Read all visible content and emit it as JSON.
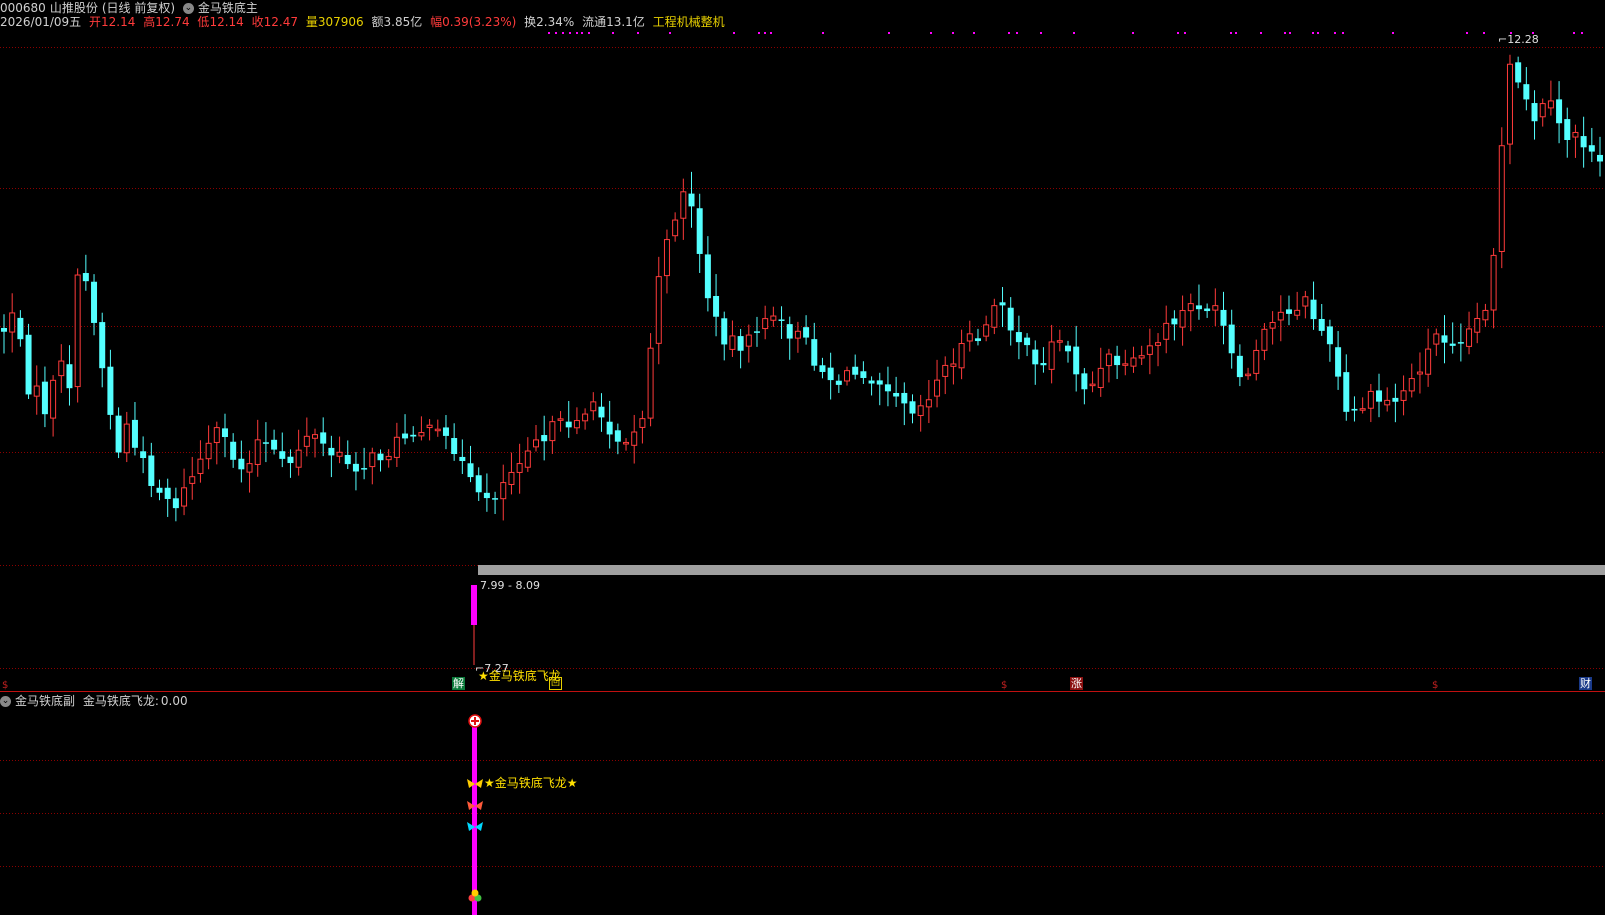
{
  "header": {
    "code": "000680",
    "name": "山推股份",
    "period": "(日线 前复权)",
    "indicator_main": "金马铁底主",
    "date": "2026/01/09",
    "weekday": "五",
    "open_label": "开",
    "open": "12.14",
    "high_label": "高",
    "high": "12.74",
    "low_label": "低",
    "low": "12.14",
    "close_label": "收",
    "close": "12.47",
    "vol_label": "量",
    "vol": "307906",
    "amt_label": "额",
    "amt": "3.85亿",
    "chg_label": "幅",
    "chg": "0.39(3.23%)",
    "turn_label": "换",
    "turn": "2.34%",
    "float_label": "流通",
    "float": "13.1亿",
    "industry": "工程机械整机"
  },
  "main_chart": {
    "high_marker": "12.28",
    "low_marker": "7.27",
    "zone_label": "7.99 - 8.09",
    "signal_text": "★金马铁底飞龙",
    "marks": {
      "jie": "解",
      "hui": "回",
      "zhang": "涨",
      "cai": "财"
    }
  },
  "sub_panel": {
    "title": "金马铁底副",
    "value_label": "金马铁底飞龙:",
    "value": "0.00",
    "signal_text": "★金马铁底飞龙★"
  },
  "colors": {
    "up": "#ff3b3b",
    "down": "#54ffff",
    "grid": "#8b0000",
    "magenta": "#ff00ff",
    "zone": "#a0a0a0"
  }
}
